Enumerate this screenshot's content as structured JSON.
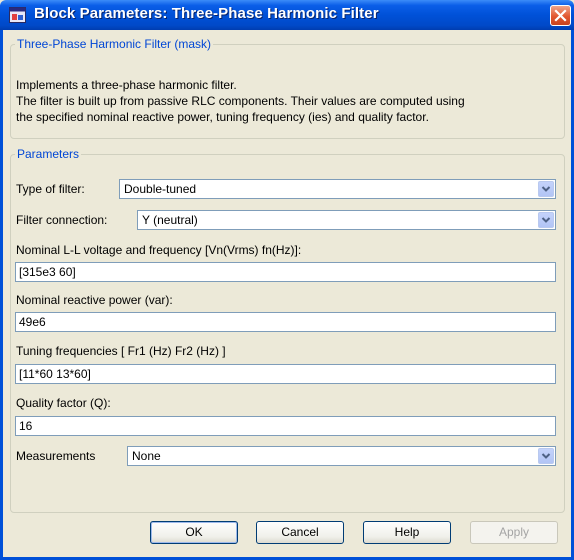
{
  "window": {
    "title": "Block Parameters: Three-Phase Harmonic Filter"
  },
  "mask_group": {
    "legend": "Three-Phase Harmonic Filter (mask)",
    "description_lines": [
      "Implements a three-phase harmonic filter.",
      "The filter is built up from passive RLC components. Their values are computed using",
      "the specified  nominal reactive power, tuning frequency (ies) and quality factor."
    ]
  },
  "params_group": {
    "legend": "Parameters",
    "type_of_filter": {
      "label": "Type of filter:",
      "value": "Double-tuned"
    },
    "filter_connection": {
      "label": "Filter connection:",
      "value": "Y (neutral)"
    },
    "nominal_voltage": {
      "label": "Nominal L-L voltage and frequency  [Vn(Vrms) fn(Hz)]:",
      "value": "[315e3 60]"
    },
    "reactive_power": {
      "label": "Nominal reactive power (var):",
      "value": "49e6"
    },
    "tuning_frequencies": {
      "label": "Tuning frequencies [ Fr1 (Hz)   Fr2 (Hz) ]",
      "value": "[11*60 13*60]"
    },
    "quality_factor": {
      "label": "Quality factor (Q):",
      "value": "16"
    },
    "measurements": {
      "label": "Measurements",
      "value": "None"
    }
  },
  "buttons": {
    "ok": "OK",
    "cancel": "Cancel",
    "help": "Help",
    "apply": "Apply"
  },
  "icons": {
    "app_icon": "simulink-block-icon",
    "close": "close-icon",
    "dropdown": "chevron-down-icon"
  },
  "colors": {
    "titlebar": "#0050d8",
    "dialog_bg": "#ece9d8",
    "legend_text": "#0046d5",
    "close_button": "#e2572f"
  }
}
